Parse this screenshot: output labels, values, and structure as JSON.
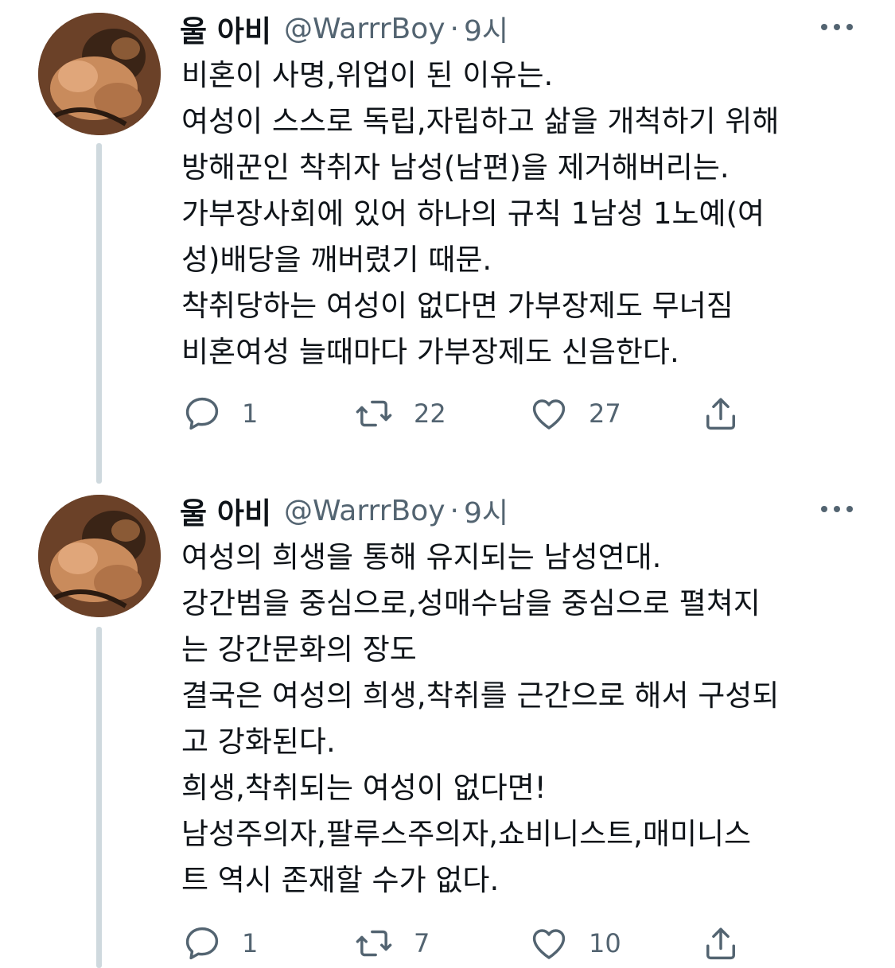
{
  "tweets": [
    {
      "name": "울 아비",
      "handle": "@WarrrBoy",
      "separator": "·",
      "time": "9시",
      "avatar_icon": "avatar-painting",
      "text_lines": [
        "비혼이 사명,위업이 된 이유는.",
        "여성이 스스로 독립,자립하고 삶을 개척하기 위해",
        "방해꾼인 착취자 남성(남편)을 제거해버리는.",
        "가부장사회에 있어 하나의 규칙 1남성 1노예(여",
        "성)배당을 깨버렸기 때문.",
        "착취당하는 여성이 없다면 가부장제도 무너짐",
        "비혼여성 늘때마다 가부장제도 신음한다."
      ],
      "replies": "1",
      "retweets": "22",
      "likes": "27"
    },
    {
      "name": "울 아비",
      "handle": "@WarrrBoy",
      "separator": "·",
      "time": "9시",
      "avatar_icon": "avatar-painting",
      "text_lines": [
        "여성의 희생을 통해 유지되는 남성연대.",
        "강간범을 중심으로,성매수남을 중심으로 펼쳐지",
        "는 강간문화의 장도",
        "결국은 여성의 희생,착취를 근간으로 해서 구성되",
        "고 강화된다.",
        "희생,착취되는 여성이 없다면!",
        "남성주의자,팔루스주의자,쇼비니스트,매미니스",
        "트 역시 존재할 수가 없다."
      ],
      "replies": "1",
      "retweets": "7",
      "likes": "10"
    }
  ],
  "colors": {
    "text": "#0f1419",
    "secondary": "#536471",
    "thread_line": "#cfd9de"
  }
}
